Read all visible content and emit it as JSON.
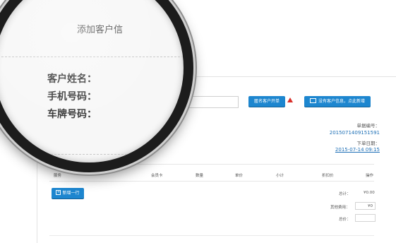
{
  "lens": {
    "title": "添加客户信",
    "fields": [
      "客户姓名：",
      "手机号码：",
      "车牌号码："
    ]
  },
  "customer": {
    "anonymous_button": "匿名客户开单",
    "new_customer_button": "没有客户信息，点此新增"
  },
  "order": {
    "number_label": "单据编号：",
    "number_value": "2015071409151591",
    "date_label": "下单日期：",
    "date_value": "2015-07-14 09:15"
  },
  "table": {
    "headers": [
      "服务",
      "会员卡",
      "数量",
      "单价",
      "小计",
      "折扣价",
      "操作"
    ],
    "add_row_button": "新增一行"
  },
  "summary": {
    "total_label": "总计：",
    "total_value": "¥0.00",
    "other_fee_label": "其他费用：",
    "other_fee_value": "¥0",
    "grand_label": "总价："
  },
  "colors": {
    "accent": "#1d86cf",
    "link": "#1d6fb6",
    "warning": "#d9302b"
  }
}
